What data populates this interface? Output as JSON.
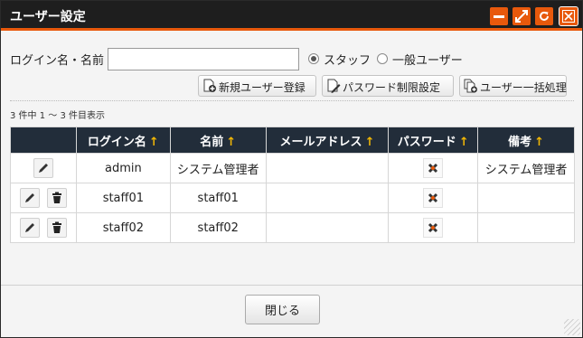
{
  "window": {
    "title": "ユーザー設定"
  },
  "titlebar_buttons": [
    {
      "icon": "minimize-icon"
    },
    {
      "icon": "maximize-icon"
    },
    {
      "icon": "refresh-icon"
    },
    {
      "icon": "close-icon"
    }
  ],
  "search": {
    "label": "ログイン名・名前",
    "value": "",
    "placeholder": "",
    "radio_options": [
      {
        "label": "スタッフ",
        "selected": true
      },
      {
        "label": "一般ユーザー",
        "selected": false
      }
    ]
  },
  "actions": {
    "new_user": "新規ユーザー登録",
    "password_restrict": "パスワード制限設定",
    "bulk_users": "ユーザー一括処理"
  },
  "count_text": "3 件中 1 ～ 3 件目表示",
  "table": {
    "sort_indicator": "↑",
    "columns": [
      "",
      "ログイン名",
      "名前",
      "メールアドレス",
      "パスワード",
      "備考"
    ],
    "rows": [
      {
        "login": "admin",
        "name": "システム管理者",
        "email": "",
        "note": "システム管理者",
        "can_delete": false
      },
      {
        "login": "staff01",
        "name": "staff01",
        "email": "",
        "note": "",
        "can_delete": true
      },
      {
        "login": "staff02",
        "name": "staff02",
        "email": "",
        "note": "",
        "can_delete": true
      }
    ]
  },
  "footer": {
    "close_label": "閉じる"
  },
  "colors": {
    "accent": "#e8590c",
    "titlebar": "#1e1e1e",
    "table_header": "#222d3a",
    "sort_arrow": "#f2b705"
  }
}
